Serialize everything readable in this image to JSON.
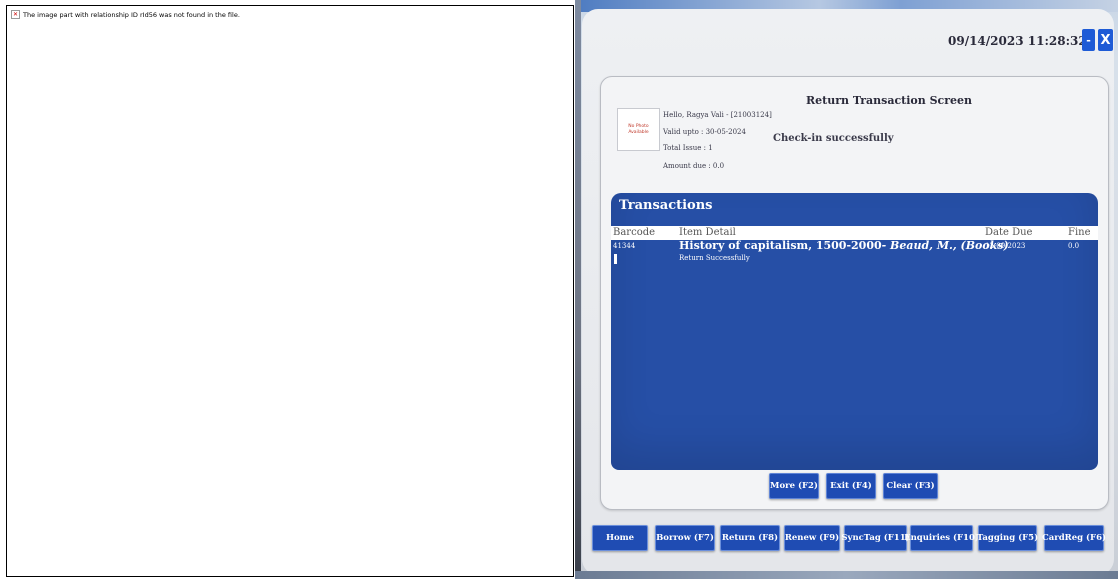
{
  "broken_image": {
    "message": "The image part with relationship ID rId56 was not found in the file.",
    "icon": "broken-image-icon"
  },
  "window": {
    "datetime": "09/14/2023 11:28:32",
    "minimize_label": "-",
    "close_label": "X"
  },
  "patron": {
    "photo_placeholder_line1": "No Photo",
    "photo_placeholder_line2": "Available",
    "greeting": "Hello, Ragya Vali - [21003124]",
    "valid_upto": "Valid upto : 30-05-2024",
    "total_issues": "Total Issue : 1",
    "amount_due": "Amount due : 0.0"
  },
  "screen": {
    "title": "Return Transaction Screen",
    "status": "Check-in successfully"
  },
  "transactions": {
    "title": "Transactions",
    "columns": [
      "Barcode",
      "Item Detail",
      "Date Due",
      "Fine"
    ],
    "rows": [
      {
        "barcode": "41344",
        "title": "History of capitalism, 1500-2000",
        "author": "- Beaud, M., (Books)",
        "status": "Return Successfully",
        "date_due": "12-09-2023",
        "fine": "0.0"
      }
    ]
  },
  "actions": {
    "more": "More (F2)",
    "exit": "Exit (F4)",
    "clear": "Clear (F3)"
  },
  "nav": {
    "items": [
      "Home",
      "Borrow (F7)",
      "Return (F8)",
      "Renew (F9)",
      "SyncTag (F11)",
      "Enquiries (F10)",
      "Tagging (F5)",
      "CardReg (F6)"
    ]
  },
  "colors": {
    "accent": "#1f4cb3",
    "transactions_bg": "#264fa6",
    "window_button": "#1e5bd6"
  }
}
